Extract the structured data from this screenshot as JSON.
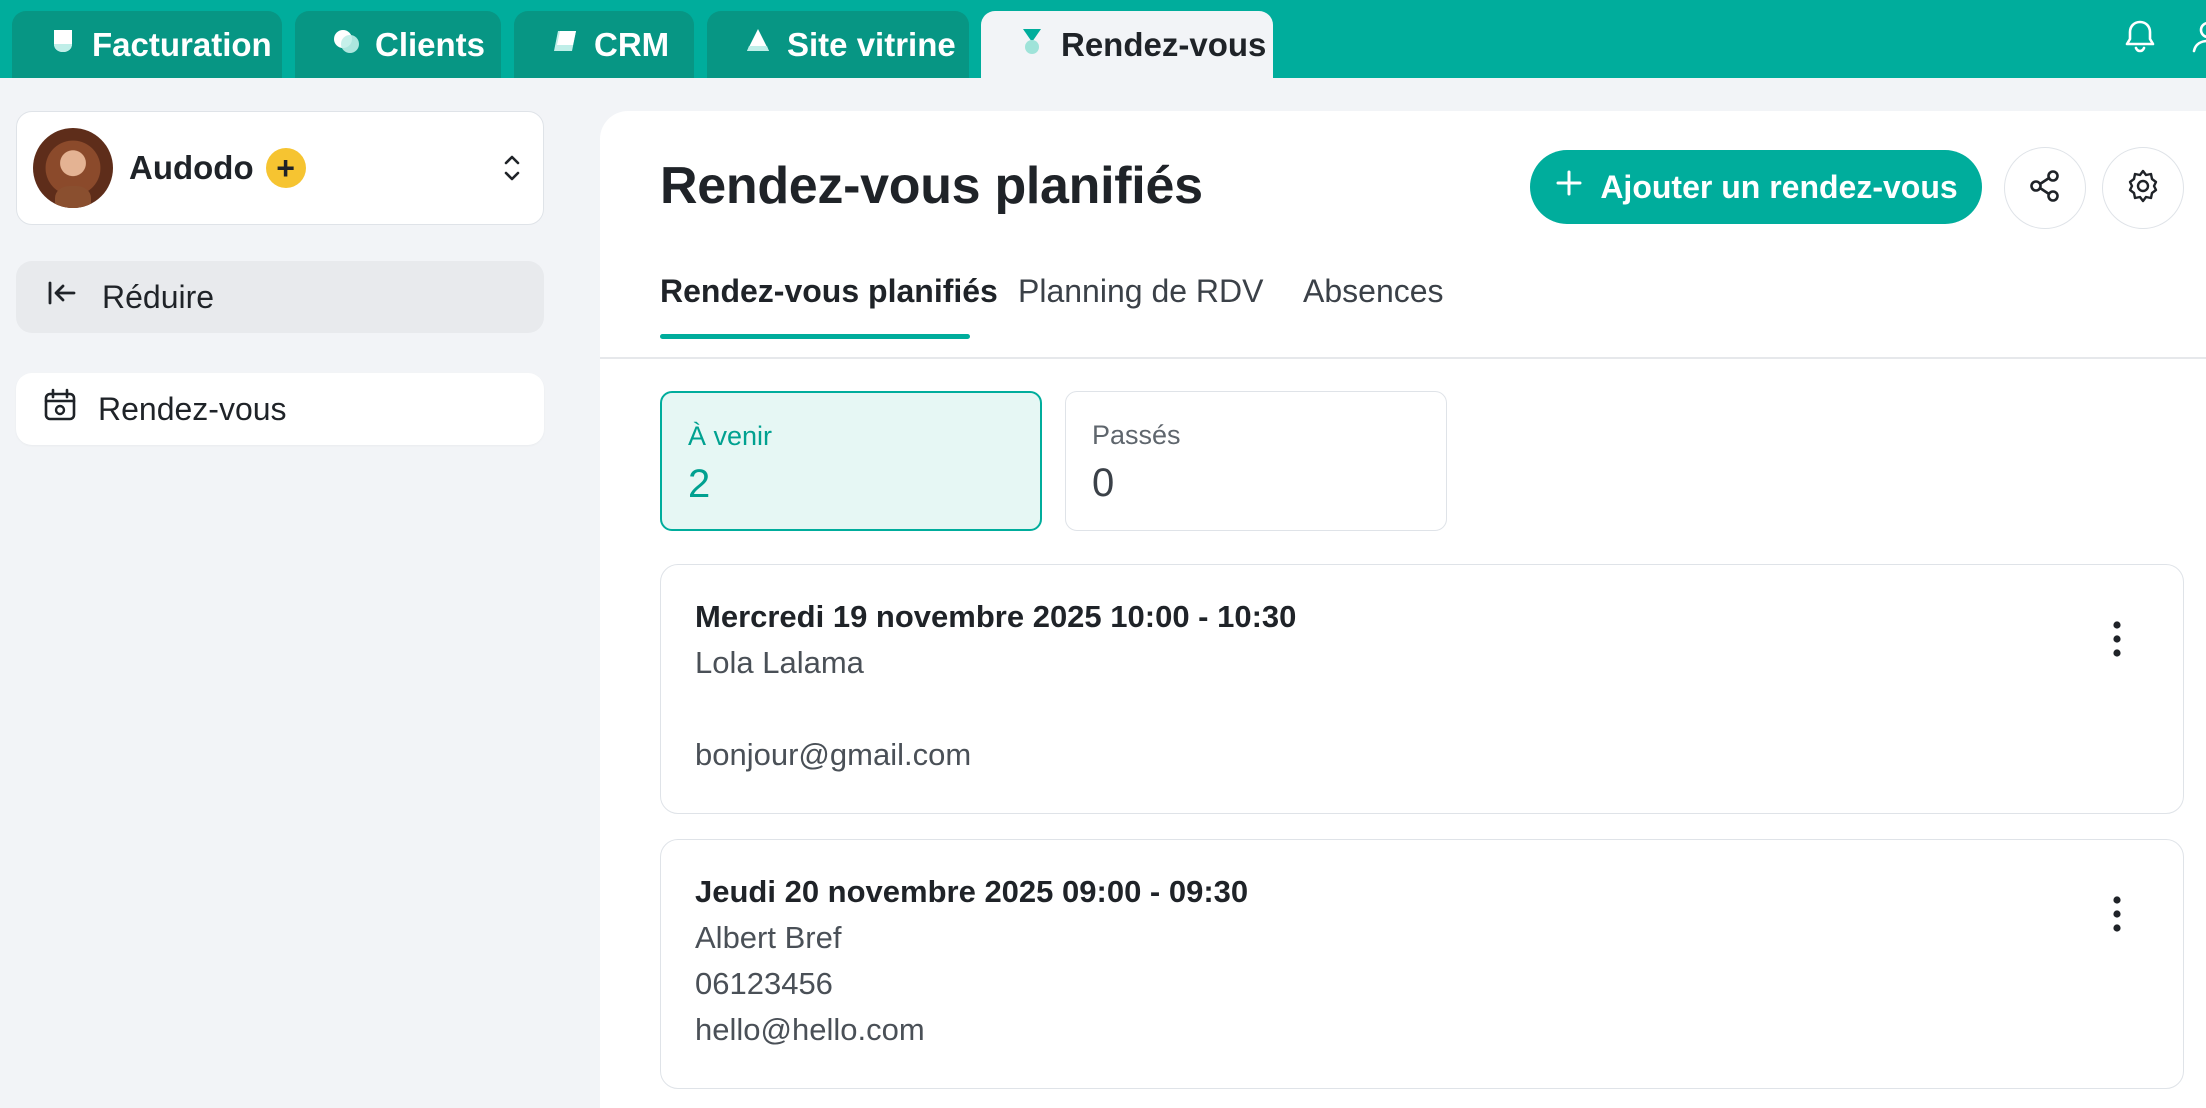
{
  "top_tabs": [
    {
      "label": "Facturation",
      "active": false
    },
    {
      "label": "Clients",
      "active": false
    },
    {
      "label": "CRM",
      "active": false
    },
    {
      "label": "Site vitrine",
      "active": false
    },
    {
      "label": "Rendez-vous",
      "active": true
    }
  ],
  "top_icons": [
    "bell-icon",
    "user-icon"
  ],
  "sidebar": {
    "account": {
      "name": "Audodo",
      "badge": "+"
    },
    "collapse_label": "Réduire",
    "items": [
      {
        "label": "Rendez-vous",
        "icon": "calendar-icon"
      }
    ]
  },
  "main": {
    "title": "Rendez-vous planifiés",
    "add_button_label": "Ajouter un rendez-vous",
    "tabs": [
      {
        "label": "Rendez-vous planifiés",
        "active": true
      },
      {
        "label": "Planning de RDV",
        "active": false
      },
      {
        "label": "Absences",
        "active": false
      }
    ],
    "stats": [
      {
        "label": "À venir",
        "value": "2",
        "active": true
      },
      {
        "label": "Passés",
        "value": "0",
        "active": false
      }
    ],
    "appointments": [
      {
        "datetime": "Mercredi 19 novembre 2025 10:00 - 10:30",
        "name": "Lola Lalama",
        "phone": "",
        "email": "bonjour@gmail.com"
      },
      {
        "datetime": "Jeudi 20 novembre 2025 09:00 - 09:30",
        "name": "Albert Bref",
        "phone": "06123456",
        "email": "hello@hello.com"
      }
    ]
  },
  "colors": {
    "accent": "#00ad9c",
    "tab_dark": "#079684",
    "active_stat_bg": "#e6f7f4",
    "badge": "#f6c431"
  }
}
